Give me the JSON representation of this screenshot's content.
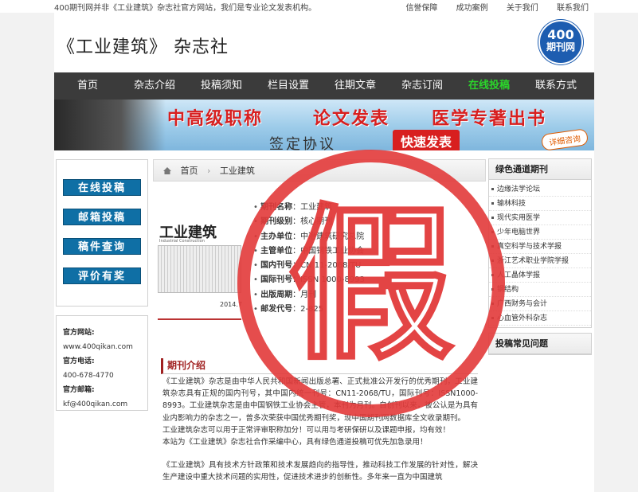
{
  "topbar": {
    "notice": "400期刊网并非《工业建筑》杂志社官方网站，我们是专业论文发表机构。",
    "links": [
      "信誉保障",
      "成功案例",
      "关于我们",
      "联系我们"
    ]
  },
  "header": {
    "site_title": "《工业建筑》 杂志社",
    "logo_num": "400",
    "logo_text": "期刊网"
  },
  "nav": {
    "items": [
      "首页",
      "杂志介绍",
      "投稿须知",
      "栏目设置",
      "往期文章",
      "杂志订阅",
      "在线投稿",
      "联系方式"
    ],
    "active_index": 6
  },
  "banner": {
    "text1": "中高级职称",
    "text2": "论文发表",
    "text3": "医学专著出书",
    "text4": "签定协议",
    "text5": "快速发表",
    "text6": "详细咨询"
  },
  "left": {
    "buttons": [
      "在线投稿",
      "邮箱投稿",
      "稿件查询",
      "评价有奖"
    ],
    "contact": {
      "site_label": "官方网站:",
      "site_value": "www.400qikan.com",
      "phone_label": "官方电话:",
      "phone_value": "400-678-4770",
      "email_label": "官方邮箱:",
      "email_value": "kf@400qikan.com"
    }
  },
  "main": {
    "breadcrumb_home": "首页",
    "breadcrumb_current": "工业建筑",
    "cover_title": "工业建筑",
    "cover_sub": "Industrial Construction",
    "cover_date": "2014.7",
    "info": [
      {
        "k": "期刊名称",
        "v": "工业建筑"
      },
      {
        "k": "期刊级别",
        "v": "核心期刊"
      },
      {
        "k": "主办单位",
        "v": "中冶建筑研究总院"
      },
      {
        "k": "主管单位",
        "v": "中国钢铁工业协会"
      },
      {
        "k": "国内刊号",
        "v": "CN 11-2068/TU"
      },
      {
        "k": "国际刊号",
        "v": "ISSN 1000-8993"
      },
      {
        "k": "出版周期",
        "v": "月刊"
      },
      {
        "k": "邮发代号",
        "v": "2-825"
      }
    ],
    "section_title": "期刊介绍",
    "intro_p1": "《工业建筑》杂志是由中华人民共和国新闻出版总署、正式批准公开发行的优秀期刊，工业建筑杂志具有正规的国内刊号，其中国内统一刊号：CN11-2068/TU，国际刊号：ISSN1000-8993。工业建筑杂志是由中国钢铁工业协会主管，本刊为月刊。自创刊以来，被公认是为具有业内影响力的杂志之一，曾多次荣获中国优秀期刊奖，现中国期刊网数据库全文收录期刊。",
    "intro_p2": "工业建筑杂志可以用于正常评审职称加分！可以用与考研保研以及课题申报，均有效！",
    "intro_p3": "本站为《工业建筑》杂志社合作采编中心，具有绿色通道投稿可优先加急录用！",
    "intro_p4": "《工业建筑》具有技术方针政策和技术发展趋向的指导性，推动科技工作发展的针对性，解决生产建设中重大技术问题的实用性，促进技术进步的创新性。多年来一直为中国建筑"
  },
  "right": {
    "head1": "绿色通道期刊",
    "items": [
      "边缘法学论坛",
      "输林科技",
      "现代实用医学",
      "少年电脑世界",
      "真空科学与技术学报",
      "浙江艺术职业学院学报",
      "人工晶体学报",
      "钢结构",
      "广西财务与会计",
      "心血管外科杂志"
    ],
    "head2": "投稿常见问题"
  },
  "stamp": {
    "char": "假",
    "color": "#e23a3a"
  }
}
